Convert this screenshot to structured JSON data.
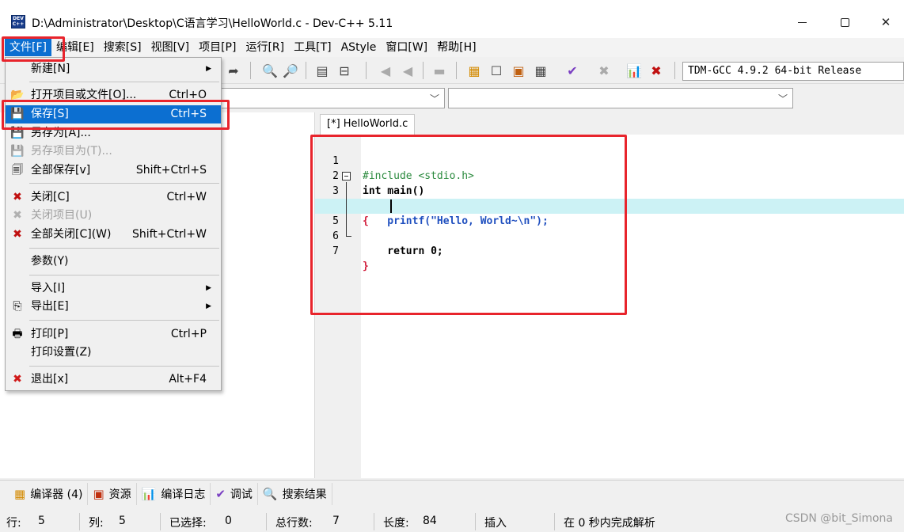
{
  "window": {
    "title": "D:\\Administrator\\Desktop\\C语言学习\\HelloWorld.c - Dev-C++ 5.11",
    "icon_text": "DEV C++"
  },
  "menubar": {
    "items": [
      {
        "label": "文件[F]"
      },
      {
        "label": "编辑[E]"
      },
      {
        "label": "搜索[S]"
      },
      {
        "label": "视图[V]"
      },
      {
        "label": "项目[P]"
      },
      {
        "label": "运行[R]"
      },
      {
        "label": "工具[T]"
      },
      {
        "label": "AStyle"
      },
      {
        "label": "窗口[W]"
      },
      {
        "label": "帮助[H]"
      }
    ]
  },
  "toolbar": {
    "compiler": "TDM-GCC 4.9.2 64-bit Release"
  },
  "file_menu": {
    "items": [
      {
        "label": "新建[N]",
        "shortcut": "",
        "submenu": true,
        "icon": ""
      },
      {
        "label": "打开项目或文件[O]...",
        "shortcut": "Ctrl+O",
        "submenu": false,
        "icon": "open-folder-icon"
      },
      {
        "label": "保存[S]",
        "shortcut": "Ctrl+S",
        "submenu": false,
        "icon": "floppy-disk-icon"
      },
      {
        "label": "另存为[A]...",
        "shortcut": "",
        "submenu": false,
        "icon": "save-as-icon"
      },
      {
        "label": "另存项目为(T)...",
        "shortcut": "",
        "submenu": false,
        "icon": "save-project-icon"
      },
      {
        "label": "全部保存[v]",
        "shortcut": "Shift+Ctrl+S",
        "submenu": false,
        "icon": "save-all-icon"
      },
      {
        "label": "关闭[C]",
        "shortcut": "Ctrl+W",
        "submenu": false,
        "icon": "close-file-icon"
      },
      {
        "label": "关闭项目(U)",
        "shortcut": "",
        "submenu": false,
        "icon": "close-project-icon"
      },
      {
        "label": "全部关闭[C](W)",
        "shortcut": "Shift+Ctrl+W",
        "submenu": false,
        "icon": "close-all-icon"
      },
      {
        "label": "参数(Y)",
        "shortcut": "",
        "submenu": false,
        "icon": ""
      },
      {
        "label": "导入[I]",
        "shortcut": "",
        "submenu": true,
        "icon": ""
      },
      {
        "label": "导出[E]",
        "shortcut": "",
        "submenu": true,
        "icon": "export-icon"
      },
      {
        "label": "打印[P]",
        "shortcut": "Ctrl+P",
        "submenu": false,
        "icon": "printer-icon"
      },
      {
        "label": "打印设置(Z)",
        "shortcut": "",
        "submenu": false,
        "icon": ""
      },
      {
        "label": "退出[x]",
        "shortcut": "Alt+F4",
        "submenu": false,
        "icon": "exit-icon"
      }
    ]
  },
  "editor": {
    "tab_label": "[*] HelloWorld.c",
    "lines": [
      {
        "num": "1",
        "text": "#include <stdio.h>"
      },
      {
        "num": "2",
        "text": "int main()"
      },
      {
        "num": "3",
        "text": "{"
      },
      {
        "num": "4",
        "text": "    printf(\"Hello, World~\\n\");"
      },
      {
        "num": "5",
        "text": ""
      },
      {
        "num": "6",
        "text": "    return 0;"
      },
      {
        "num": "7",
        "text": "}"
      }
    ]
  },
  "bottom_tabs": [
    {
      "label": "编译器 (4)",
      "icon": "compiler-grid-icon"
    },
    {
      "label": "资源",
      "icon": "resources-icon"
    },
    {
      "label": "编译日志",
      "icon": "bar-chart-icon"
    },
    {
      "label": "调试",
      "icon": "checkmark-icon"
    },
    {
      "label": "搜索结果",
      "icon": "search-results-icon"
    }
  ],
  "statusbar": {
    "row_label": "行:",
    "row_value": "5",
    "col_label": "列:",
    "col_value": "5",
    "sel_label": "已选择:",
    "sel_value": "0",
    "total_label": "总行数:",
    "total_value": "7",
    "len_label": "长度:",
    "len_value": "84",
    "mode": "插入",
    "parse": "在 0 秒内完成解析"
  },
  "watermark": "CSDN @bit_Simona",
  "colors": {
    "menu_highlight": "#0c6fd1",
    "current_line": "#ccf2f5",
    "annotation_red": "#e8242c"
  }
}
